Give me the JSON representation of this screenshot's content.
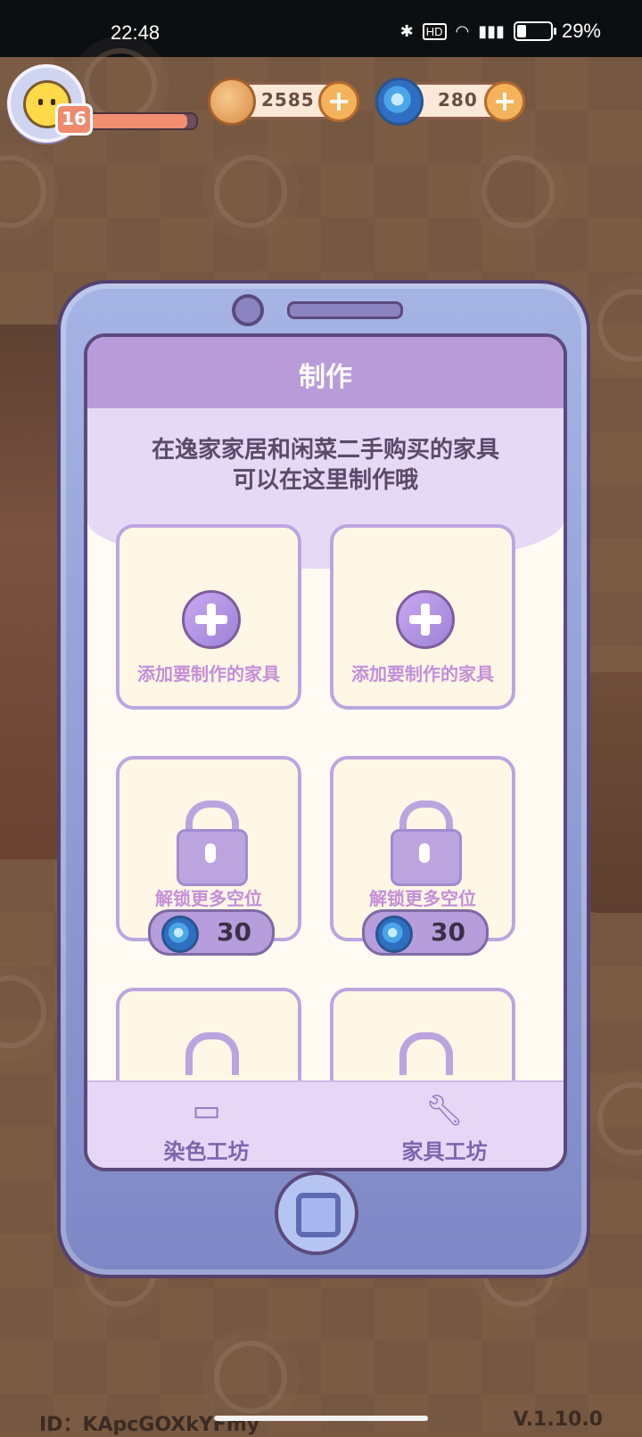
{
  "status_bar": {
    "time": "22:48",
    "battery": "29%",
    "battery_level": 0.29,
    "icons": [
      "bluetooth-icon",
      "hd-icon",
      "wifi-icon",
      "5g-signal-icon",
      "battery-icon"
    ]
  },
  "hud": {
    "level": "16",
    "xp_progress": 0.92,
    "coins": "2585",
    "gems": "280"
  },
  "panel": {
    "title": "制作",
    "description_line1": "在逸家家居和闲菜二手购买的家具",
    "description_line2": "可以在这里制作哦",
    "slots": [
      {
        "type": "add",
        "label": "添加要制作的家具"
      },
      {
        "type": "add",
        "label": "添加要制作的家具"
      },
      {
        "type": "locked",
        "label": "解锁更多空位",
        "price": "30"
      },
      {
        "type": "locked",
        "label": "解锁更多空位",
        "price": "30"
      }
    ],
    "tabs": [
      {
        "label": "染色工坊",
        "icon": "paint-roller-icon"
      },
      {
        "label": "家具工坊",
        "icon": "wrench-icon"
      }
    ]
  },
  "footer": {
    "id_text": "ID：KApcGOXkYFmy",
    "version": "V.1.10.0"
  },
  "colors": {
    "panel_header": "#b89bd8",
    "slot_border": "#bca5df",
    "phone_frame": "#8d99d2"
  }
}
